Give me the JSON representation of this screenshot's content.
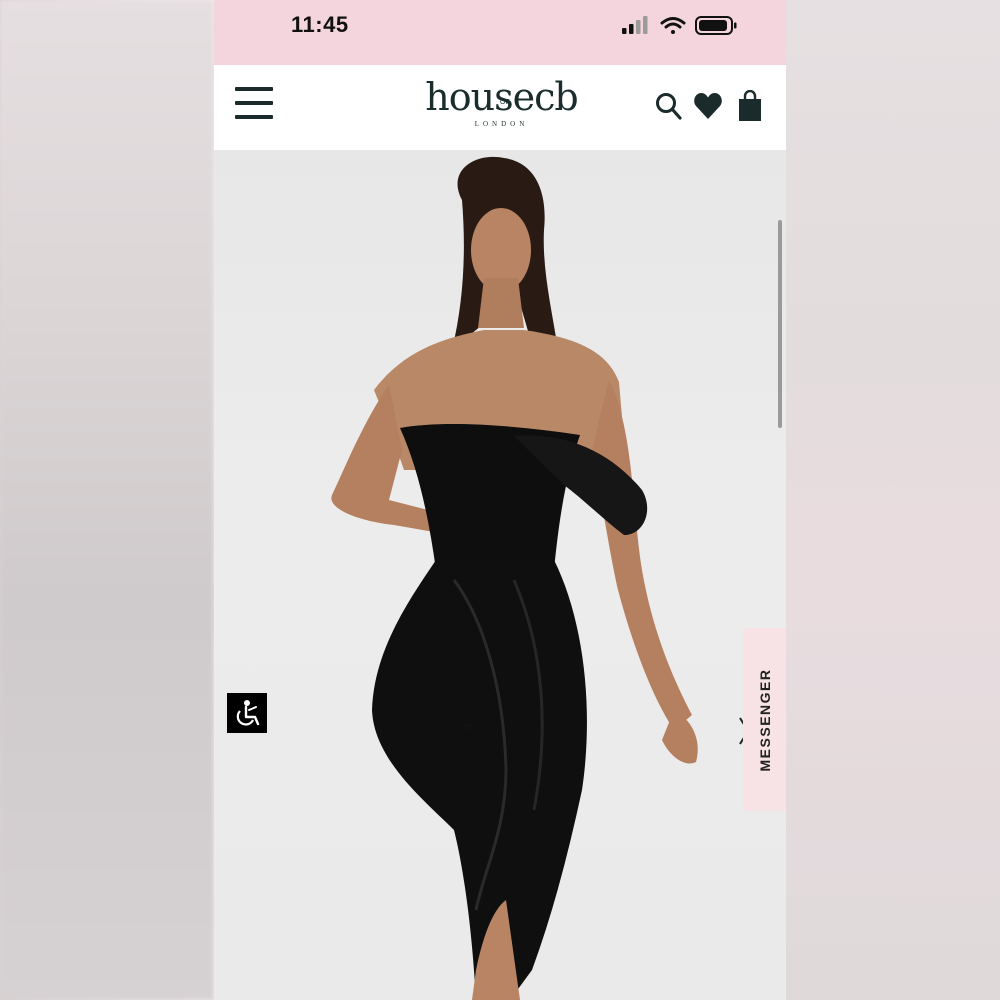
{
  "status_bar": {
    "time": "11:45",
    "icons": [
      "cellular-signal-icon",
      "wifi-icon",
      "battery-icon"
    ]
  },
  "header": {
    "logo": {
      "name": "house",
      "of": "OF",
      "cb": "cb",
      "sub": "LONDON"
    },
    "icons": [
      "hamburger-menu-icon",
      "search-icon",
      "heart-icon",
      "shopping-bag-icon"
    ]
  },
  "hero": {
    "image": "product-photo",
    "description_icons": [
      "accessibility-icon",
      "chevron-right-icon"
    ]
  },
  "messenger": {
    "label": "MESSENGER"
  },
  "colors": {
    "status_bar_bg": "#f4d5dd",
    "header_bg": "#ffffff",
    "brand_dark": "#1a2d2c",
    "messenger_bg": "#f7e3e6"
  }
}
